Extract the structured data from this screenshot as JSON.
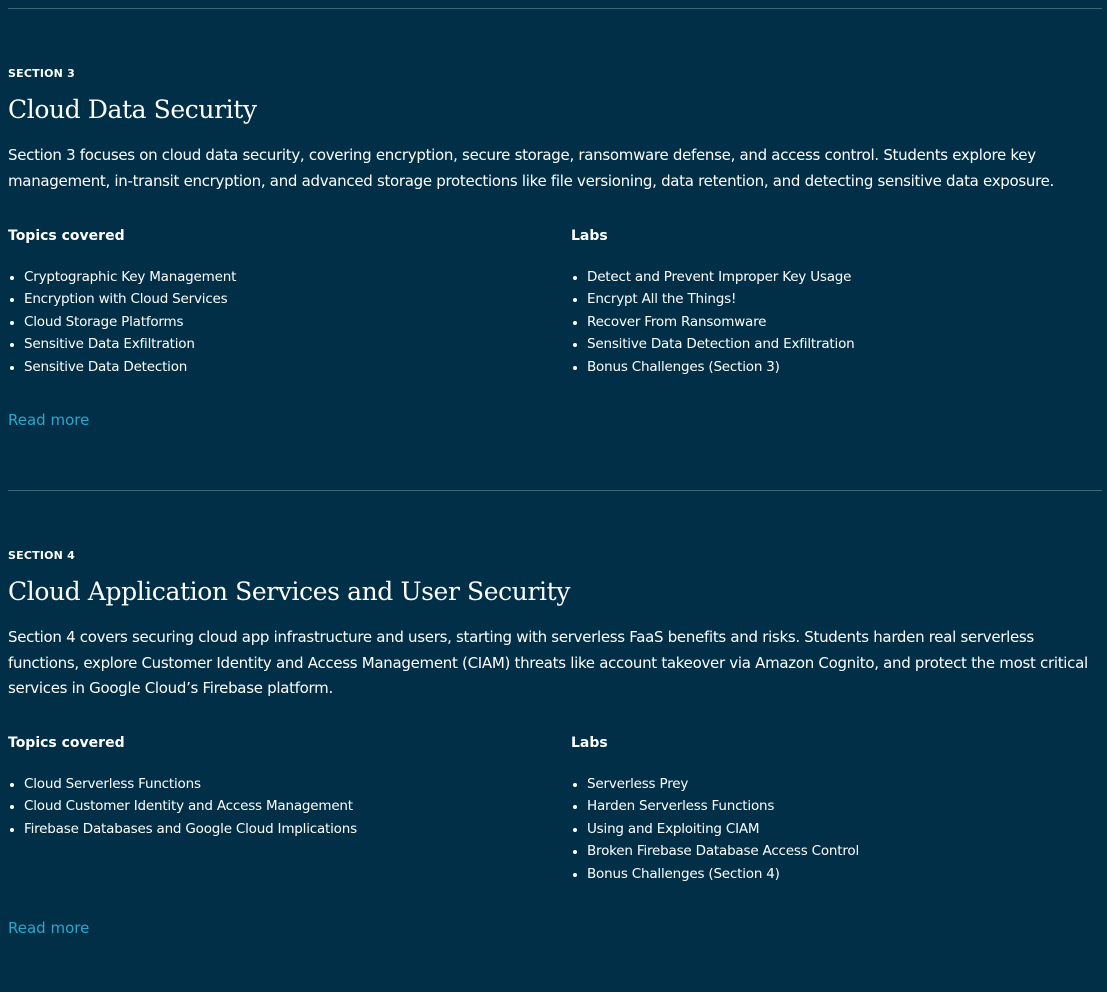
{
  "sections": [
    {
      "eyebrow": "SECTION 3",
      "title": "Cloud Data Security",
      "description": "Section 3 focuses on cloud data security, covering encryption, secure storage, ransomware defense, and access control. Students explore key management, in-transit encryption, and advanced storage protections like file versioning, data retention, and detecting sensitive data exposure.",
      "topics_heading": "Topics covered",
      "topics": [
        "Cryptographic Key Management",
        "Encryption with Cloud Services",
        "Cloud Storage Platforms",
        "Sensitive Data Exfiltration",
        "Sensitive Data Detection"
      ],
      "labs_heading": "Labs",
      "labs": [
        "Detect and Prevent Improper Key Usage",
        "Encrypt All the Things!",
        "Recover From Ransomware",
        "Sensitive Data Detection and Exfiltration",
        "Bonus Challenges (Section 3)"
      ],
      "read_more": "Read more"
    },
    {
      "eyebrow": "SECTION 4",
      "title": "Cloud Application Services and User Security",
      "description": "Section 4 covers securing cloud app infrastructure and users, starting with serverless FaaS benefits and risks. Students harden real serverless functions, explore Customer Identity and Access Management (CIAM) threats like account takeover via Amazon Cognito, and protect the most critical services in Google Cloud’s Firebase platform.",
      "topics_heading": "Topics covered",
      "topics": [
        "Cloud Serverless Functions",
        "Cloud Customer Identity and Access Management",
        "Firebase Databases and Google Cloud Implications"
      ],
      "labs_heading": "Labs",
      "labs": [
        "Serverless Prey",
        "Harden Serverless Functions",
        "Using and Exploiting CIAM",
        "Broken Firebase Database Access Control",
        "Bonus Challenges (Section 4)"
      ],
      "read_more": "Read more"
    }
  ],
  "colors": {
    "background": "#002f47",
    "text": "#ffffff",
    "link": "#2aa8cc",
    "divider": "#3d6677"
  }
}
